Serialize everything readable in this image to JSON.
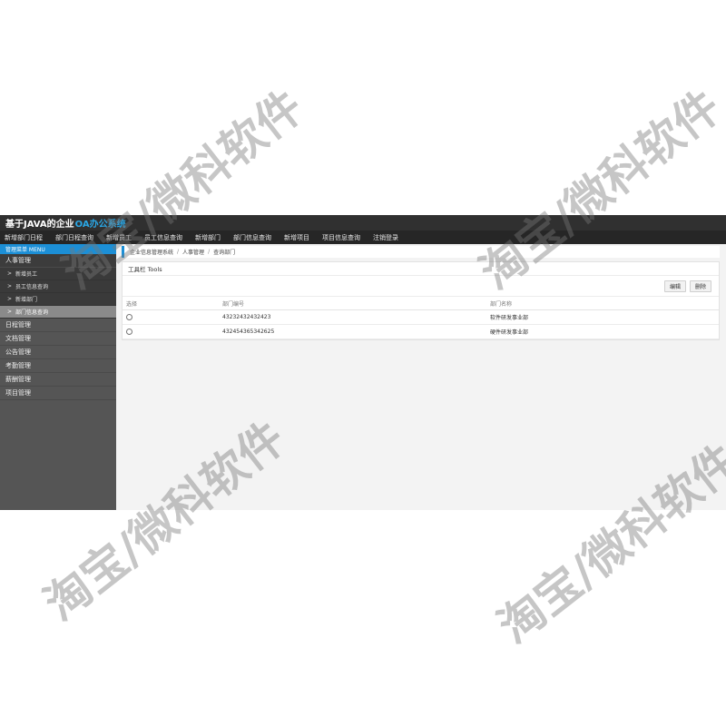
{
  "header": {
    "title_main": "基于JAVA的企业",
    "title_accent": "OA办公系统"
  },
  "topnav": [
    "新增部门日程",
    "部门日程查询",
    "新增员工",
    "员工信息查询",
    "新增部门",
    "部门信息查询",
    "新增项目",
    "项目信息查询",
    "注销登录"
  ],
  "sidebar": {
    "header": "管理菜单 MENU",
    "group_hr": "人事管理",
    "subitems": [
      "新增员工",
      "员工信息查询",
      "新增部门",
      "部门信息查询"
    ],
    "groups": [
      "日程管理",
      "文档管理",
      "公告管理",
      "考勤管理",
      "薪酬管理",
      "项目管理"
    ],
    "arrow": ">"
  },
  "breadcrumb": {
    "items": [
      "企业信息管理系统",
      "人事管理",
      "查询部门"
    ],
    "sep": "/"
  },
  "toolbar": {
    "title": "工具栏 Tools",
    "edit_label": "编辑",
    "delete_label": "删除"
  },
  "table": {
    "headers": [
      "选择",
      "部门编号",
      "部门名称"
    ],
    "rows": [
      {
        "id": "43232432432423",
        "name": "软件研发事业部"
      },
      {
        "id": "432454365342625",
        "name": "硬件研发事业部"
      }
    ]
  },
  "watermark_text": "淘宝/微科软件",
  "colors": {
    "accent": "#1c8fd6",
    "title_bar": "#303030",
    "sidebar": "#555555"
  }
}
